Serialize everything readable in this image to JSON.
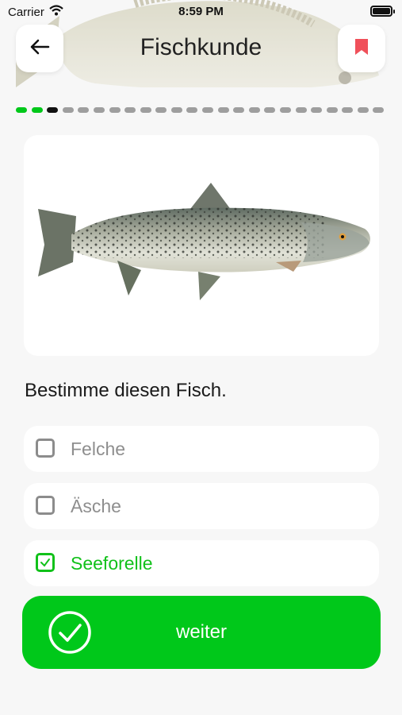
{
  "status_bar": {
    "carrier": "Carrier",
    "time": "8:59 PM"
  },
  "header": {
    "title": "Fischkunde"
  },
  "progress": {
    "total": 24,
    "completed": 2,
    "current_index": 2
  },
  "quiz": {
    "question": "Bestimme diesen Fisch.",
    "options": [
      {
        "label": "Felche",
        "checked": false
      },
      {
        "label": "Äsche",
        "checked": false
      },
      {
        "label": "Seeforelle",
        "checked": true
      }
    ],
    "next_label": "weiter"
  },
  "colors": {
    "accent_green": "#00c81a",
    "bookmark_red": "#f0505a",
    "current_dot": "#111111",
    "pending_dot": "#9e9e9e"
  },
  "icons": {
    "back": "arrow-left-icon",
    "bookmark": "bookmark-icon",
    "check": "check-circle-icon"
  }
}
